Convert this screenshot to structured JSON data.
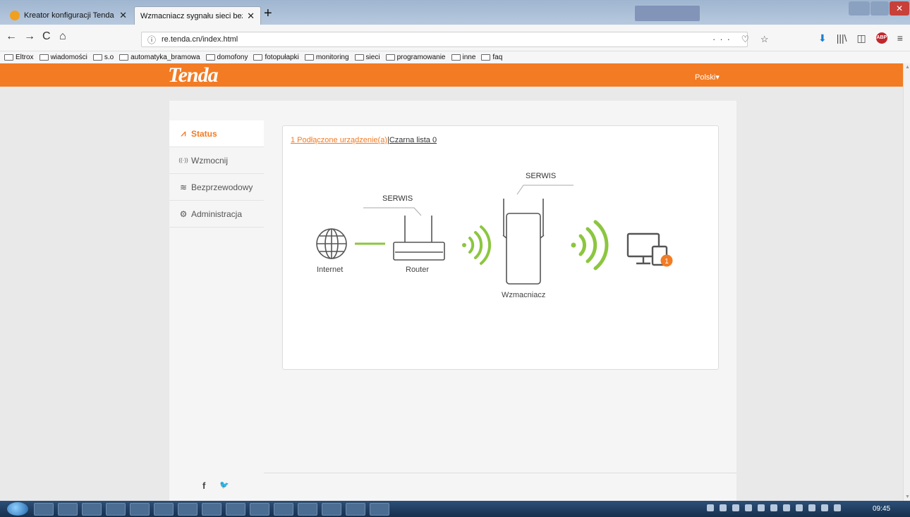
{
  "browser": {
    "tabs": [
      {
        "title": "Kreator konfiguracji Tenda",
        "close": "✕"
      },
      {
        "title": "Wzmacniacz sygnału sieci bezprzew",
        "close": "✕"
      }
    ],
    "new_tab": "+",
    "url_info_icon": "ⓘ",
    "url": "re.tenda.cn/index.html",
    "url_actions": "··· ♡ ☆",
    "bookmarks": [
      "Eltrox",
      "wiadomości",
      "s.o",
      "automatyka_bramowa",
      "domofony",
      "fotopułapki",
      "monitoring",
      "sieci",
      "programowanie",
      "inne",
      "faq"
    ],
    "nav_back": "←",
    "nav_forward": "→",
    "nav_reload": "C",
    "nav_home": "⌂",
    "tool_download": "⬇",
    "tool_library": "|||\\",
    "tool_sidebar": "◫",
    "tool_abp": "ABP",
    "tool_menu": "≡"
  },
  "page": {
    "logo": "Tenda",
    "language": "Polski▾",
    "menu": [
      {
        "label": "Status",
        "icon": "⩘"
      },
      {
        "label": "Wzmocnij",
        "icon": "((·))"
      },
      {
        "label": "Bezprzewodowy",
        "icon": "≋"
      },
      {
        "label": "Administracja",
        "icon": "⚙"
      }
    ],
    "social": {
      "facebook": "f",
      "twitter": "🐦"
    },
    "status": {
      "connected_link": "1 Podłączone urządzenie(a)",
      "separator": "|",
      "blacklist_link": "Czarna lista 0",
      "internet_label": "Internet",
      "router_label": "Router",
      "router_service": "SERWIS",
      "extender_label": "Wzmacniacz",
      "extender_service": "SERWIS",
      "device_count": "1"
    }
  },
  "taskbar": {
    "clock": "09:45"
  },
  "colors": {
    "accent": "#f37b23",
    "signal": "#8cc63f"
  }
}
